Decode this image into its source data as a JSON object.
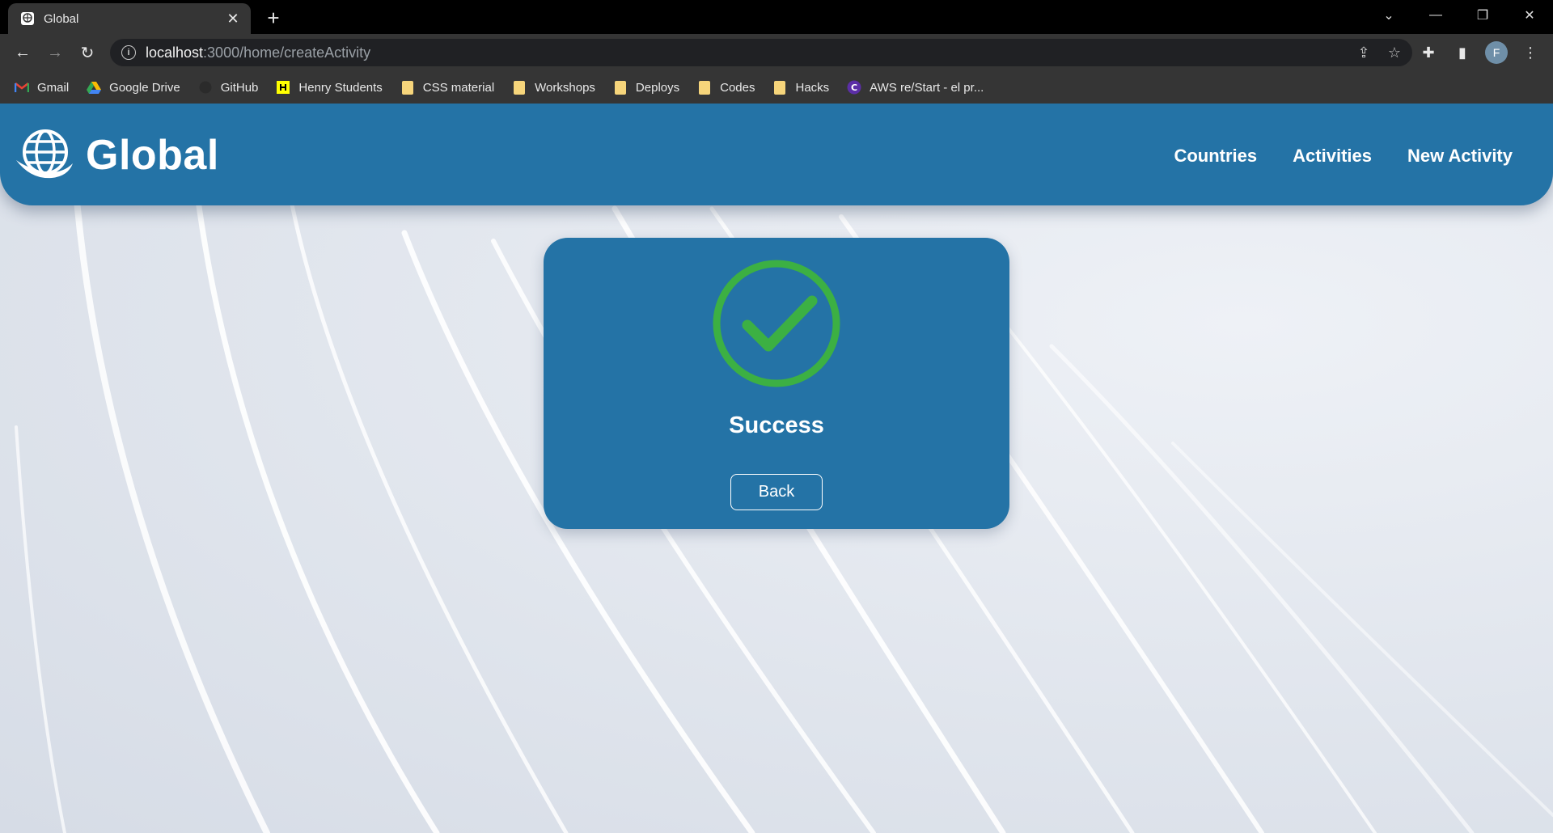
{
  "browser": {
    "tab_title": "Global",
    "url_host": "localhost",
    "url_path": ":3000/home/createActivity",
    "profile_initial": "F"
  },
  "bookmarks": [
    {
      "label": "Gmail",
      "icon": "gmail-icon"
    },
    {
      "label": "Google Drive",
      "icon": "drive-icon"
    },
    {
      "label": "GitHub",
      "icon": "github-icon"
    },
    {
      "label": "Henry Students",
      "icon": "henry-icon"
    },
    {
      "label": "CSS material",
      "icon": "folder-icon"
    },
    {
      "label": "Workshops",
      "icon": "folder-icon"
    },
    {
      "label": "Deploys",
      "icon": "folder-icon"
    },
    {
      "label": "Codes",
      "icon": "folder-icon"
    },
    {
      "label": "Hacks",
      "icon": "folder-icon"
    },
    {
      "label": "AWS re/Start - el pr...",
      "icon": "aws-icon"
    }
  ],
  "navbar": {
    "brand": "Global",
    "links": [
      "Countries",
      "Activities",
      "New Activity"
    ]
  },
  "modal": {
    "title": "Success",
    "back_label": "Back",
    "icon": "check-circle-icon"
  },
  "colors": {
    "primary": "#2473a6",
    "success": "#3cb043",
    "background": "#dfe4ec"
  }
}
